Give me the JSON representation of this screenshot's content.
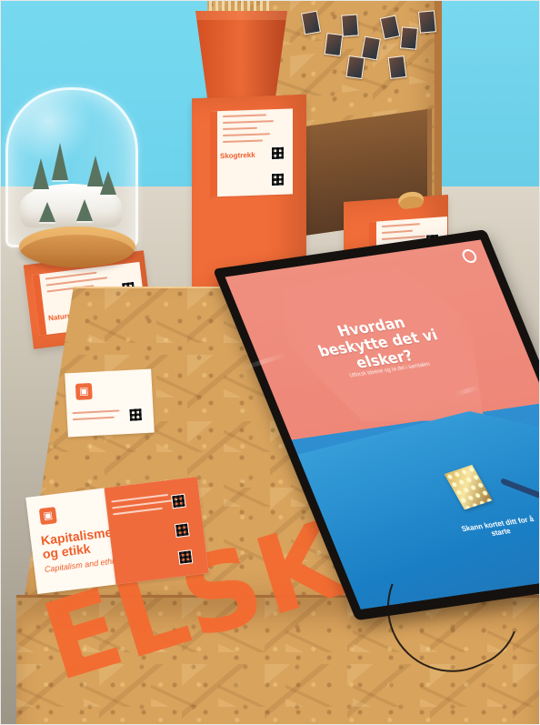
{
  "scene": {
    "screen": {
      "title": "Hvordan beskytte det vi elsker?",
      "subtitle": "Utforsk ideene og ta del i samtalen",
      "scan_label": "Skann kortet ditt for å starte"
    },
    "table": {
      "front_text": "ELSKE"
    },
    "cards": {
      "left_card_title": "Kapitalisme og etikk",
      "left_card_subtitle": "Capitalism and ethics",
      "left_pedestal_title": "Naturrike",
      "center_pedestal_title": "Skogtrekk"
    }
  }
}
